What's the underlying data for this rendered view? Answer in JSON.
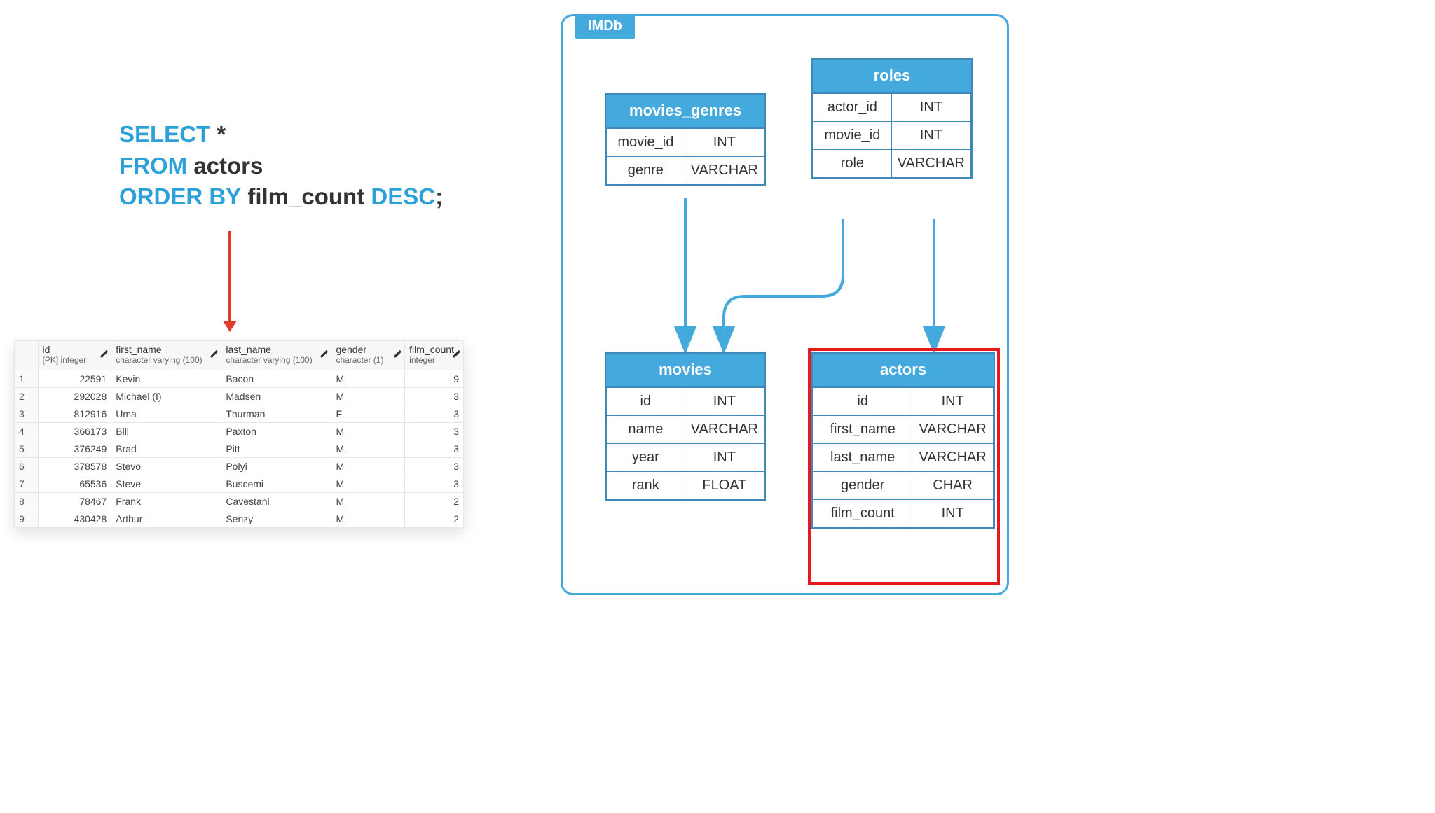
{
  "sql": {
    "kw_select": "SELECT",
    "star": " *",
    "kw_from": "FROM",
    "from_tbl": " actors",
    "kw_orderby": "ORDER BY",
    "orderby_col": " film_count ",
    "kw_desc": "DESC",
    "semicolon": ";"
  },
  "result": {
    "columns": [
      {
        "name": "id",
        "type": "[PK] integer",
        "numeric": true
      },
      {
        "name": "first_name",
        "type": "character varying (100)",
        "numeric": false
      },
      {
        "name": "last_name",
        "type": "character varying (100)",
        "numeric": false
      },
      {
        "name": "gender",
        "type": "character (1)",
        "numeric": false
      },
      {
        "name": "film_count",
        "type": "integer",
        "numeric": true
      }
    ],
    "rows": [
      [
        22591,
        "Kevin",
        "Bacon",
        "M",
        9
      ],
      [
        292028,
        "Michael (I)",
        "Madsen",
        "M",
        3
      ],
      [
        812916,
        "Uma",
        "Thurman",
        "F",
        3
      ],
      [
        366173,
        "Bill",
        "Paxton",
        "M",
        3
      ],
      [
        376249,
        "Brad",
        "Pitt",
        "M",
        3
      ],
      [
        378578,
        "Stevo",
        "Polyi",
        "M",
        3
      ],
      [
        65536,
        "Steve",
        "Buscemi",
        "M",
        3
      ],
      [
        78467,
        "Frank",
        "Cavestani",
        "M",
        2
      ],
      [
        430428,
        "Arthur",
        "Senzy",
        "M",
        2
      ]
    ]
  },
  "schema": {
    "title": "IMDb",
    "entities": {
      "movies_genres": {
        "title": "movies_genres",
        "cols": [
          [
            "movie_id",
            "INT"
          ],
          [
            "genre",
            "VARCHAR"
          ]
        ]
      },
      "roles": {
        "title": "roles",
        "cols": [
          [
            "actor_id",
            "INT"
          ],
          [
            "movie_id",
            "INT"
          ],
          [
            "role",
            "VARCHAR"
          ]
        ]
      },
      "movies": {
        "title": "movies",
        "cols": [
          [
            "id",
            "INT"
          ],
          [
            "name",
            "VARCHAR"
          ],
          [
            "year",
            "INT"
          ],
          [
            "rank",
            "FLOAT"
          ]
        ]
      },
      "actors": {
        "title": "actors",
        "cols": [
          [
            "id",
            "INT"
          ],
          [
            "first_name",
            "VARCHAR"
          ],
          [
            "last_name",
            "VARCHAR"
          ],
          [
            "gender",
            "CHAR"
          ],
          [
            "film_count",
            "INT"
          ]
        ]
      }
    },
    "highlighted_entity": "actors"
  }
}
